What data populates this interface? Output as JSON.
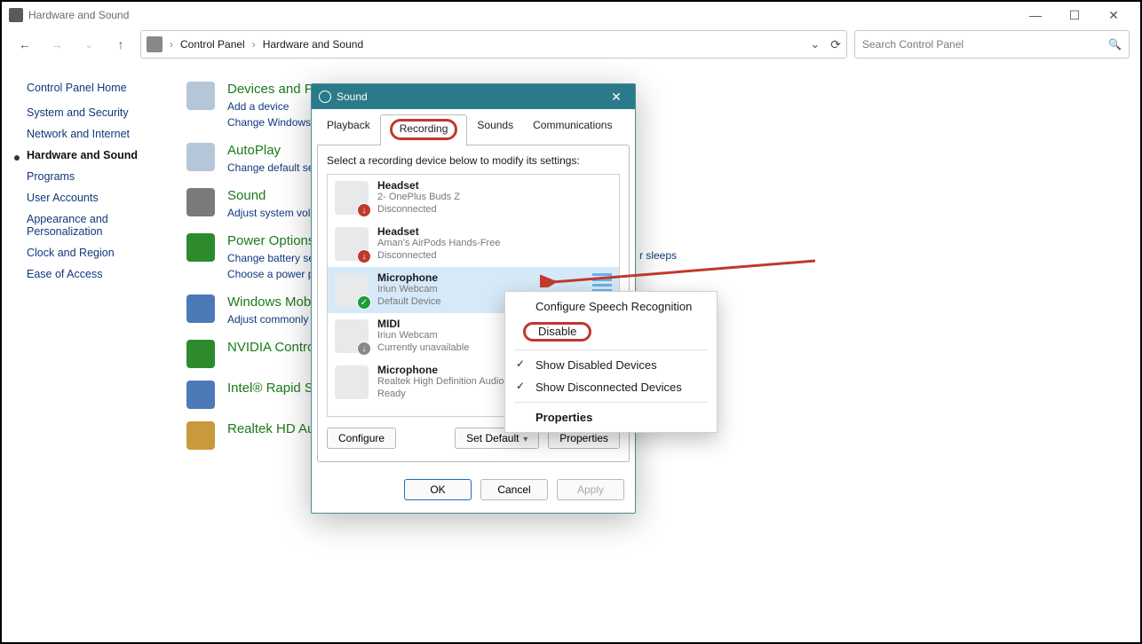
{
  "window": {
    "title": "Hardware and Sound"
  },
  "window_controls": {
    "min": "—",
    "max": "☐",
    "close": "✕"
  },
  "breadcrumbs": [
    "Control Panel",
    "Hardware and Sound"
  ],
  "search": {
    "placeholder": "Search Control Panel",
    "icon": "🔍"
  },
  "sidebar": {
    "header": "Control Panel Home",
    "items": [
      {
        "label": "System and Security",
        "current": false
      },
      {
        "label": "Network and Internet",
        "current": false
      },
      {
        "label": "Hardware and Sound",
        "current": true
      },
      {
        "label": "Programs",
        "current": false
      },
      {
        "label": "User Accounts",
        "current": false
      },
      {
        "label": "Appearance and Personalization",
        "current": false
      },
      {
        "label": "Clock and Region",
        "current": false
      },
      {
        "label": "Ease of Access",
        "current": false
      }
    ]
  },
  "categories": [
    {
      "title": "Devices and P",
      "sub": "Add a device\nChange Windows"
    },
    {
      "title": "AutoPlay",
      "sub": "Change default set"
    },
    {
      "title": "Sound",
      "sub": "Adjust system volu"
    },
    {
      "title": "Power Options",
      "sub": "Change battery set\nChoose a power pl"
    },
    {
      "title": "Windows Mob",
      "sub": "Adjust commonly"
    },
    {
      "title": "NVIDIA Contro",
      "sub": ""
    },
    {
      "title": "Intel® Rapid S",
      "sub": ""
    },
    {
      "title": "Realtek HD Au",
      "sub": ""
    }
  ],
  "dialog": {
    "title": "Sound",
    "tabs": [
      "Playback",
      "Recording",
      "Sounds",
      "Communications"
    ],
    "active_tab": "Recording",
    "instruction": "Select a recording device below to modify its settings:",
    "devices": [
      {
        "name": "Headset",
        "line2": "2- OnePlus Buds Z",
        "line3": "Disconnected",
        "badge": "red"
      },
      {
        "name": "Headset",
        "line2": "Aman's AirPods Hands-Free",
        "line3": "Disconnected",
        "badge": "red"
      },
      {
        "name": "Microphone",
        "line2": "Iriun Webcam",
        "line3": "Default Device",
        "badge": "green",
        "selected": true
      },
      {
        "name": "MIDI",
        "line2": "Iriun Webcam",
        "line3": "Currently unavailable",
        "badge": "gray"
      },
      {
        "name": "Microphone",
        "line2": "Realtek High Definition Audio",
        "line3": "Ready",
        "badge": ""
      }
    ],
    "buttons": {
      "configure": "Configure",
      "set_default": "Set Default",
      "properties": "Properties"
    },
    "footer": {
      "ok": "OK",
      "cancel": "Cancel",
      "apply": "Apply"
    }
  },
  "context_menu": {
    "items": [
      {
        "label": "Configure Speech Recognition"
      },
      {
        "label": "Disable",
        "highlight": true
      },
      {
        "sep": true
      },
      {
        "label": "Show Disabled Devices",
        "checked": true
      },
      {
        "label": "Show Disconnected Devices",
        "checked": true
      },
      {
        "sep": true
      },
      {
        "label": "Properties",
        "bold": true
      }
    ]
  },
  "peek": "r sleeps"
}
